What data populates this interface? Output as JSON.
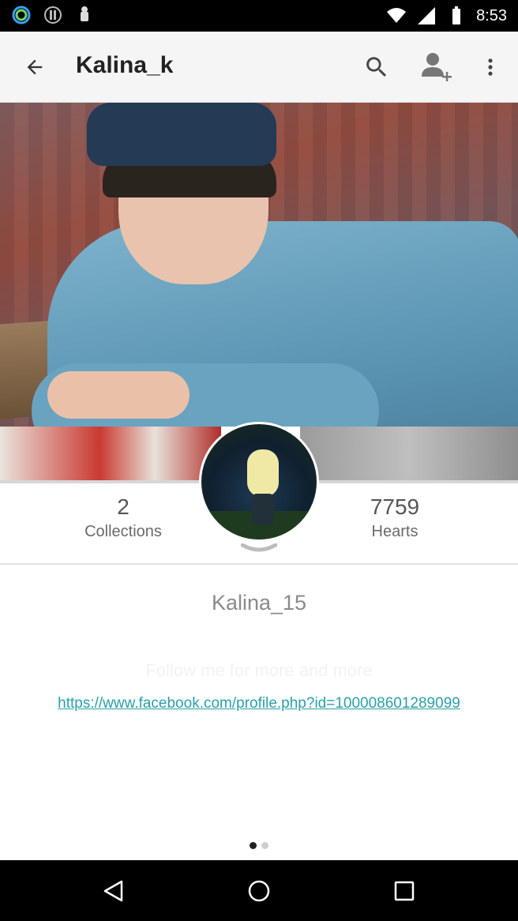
{
  "status_bar": {
    "time": "8:53",
    "icons": [
      "ring-icon",
      "info-circle-icon",
      "android-icon",
      "wifi-icon",
      "signal-icon",
      "battery-icon"
    ]
  },
  "app_bar": {
    "title": "Kalina_k",
    "icons": [
      "back-arrow-icon",
      "search-icon",
      "add-friend-icon",
      "more-vert-icon"
    ]
  },
  "stats": {
    "collections_count": "2",
    "collections_label": "Collections",
    "hearts_count": "7759",
    "hearts_label": "Hearts"
  },
  "profile": {
    "username": "Kalina_15",
    "bio_faint": "Follow me for more and more",
    "link": "https://www.facebook.com/profile.php?id=100008601289099"
  },
  "pager": {
    "pages": 2,
    "current": 1
  },
  "colors": {
    "link": "#2aa0a8",
    "app_bar_bg": "#f5f5f5",
    "status_bar_bg": "#000000"
  }
}
